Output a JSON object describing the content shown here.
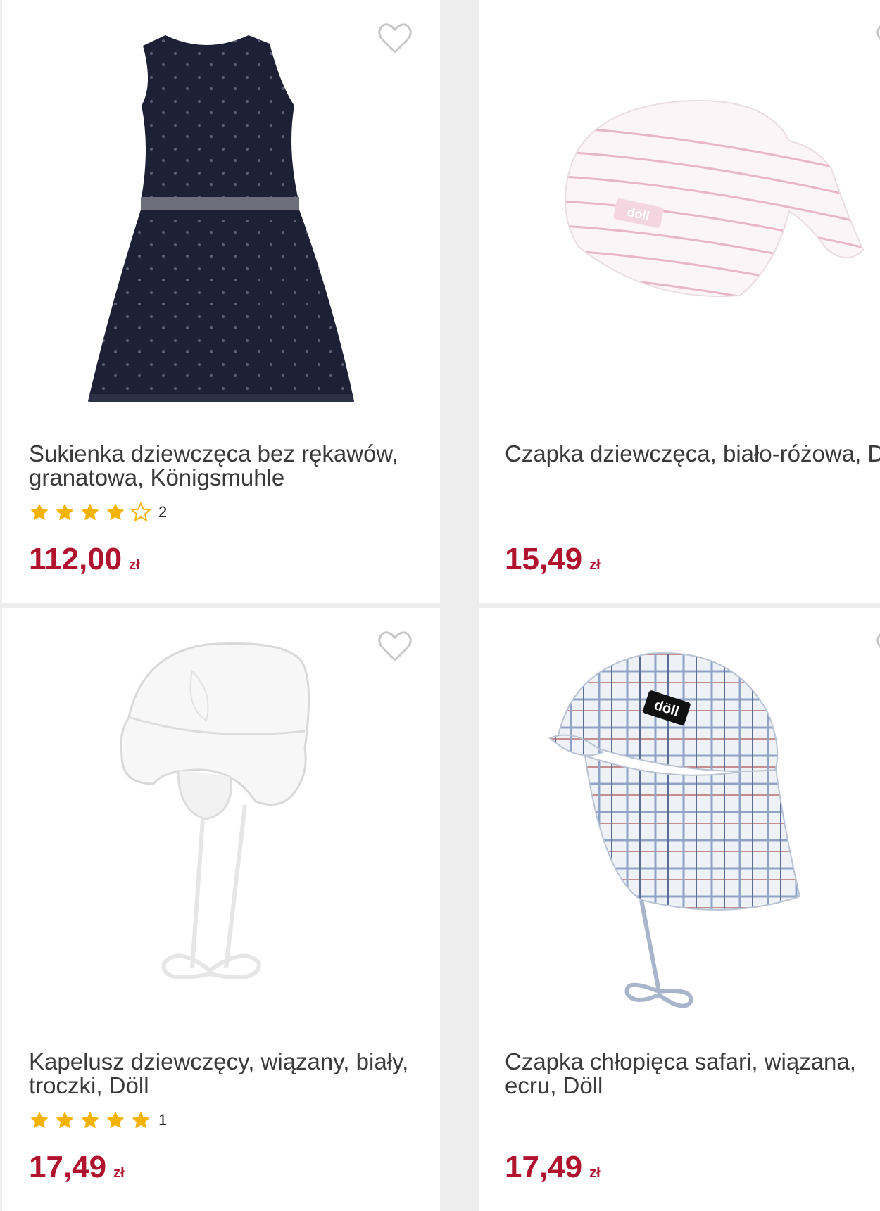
{
  "products": [
    {
      "title": "Sukienka dziewczęca bez rękawów, granatowa, Königsmuhle",
      "rating_stars": 4,
      "rating_count": "2",
      "price": "112,00",
      "currency": "zł",
      "image": "navy-dress"
    },
    {
      "title": "Czapka dziewczęca, biało-różowa, Döll",
      "rating_stars": 0,
      "rating_count": "",
      "price": "15,49",
      "currency": "zł",
      "image": "pink-striped-hat",
      "image_logo_text": "döll"
    },
    {
      "title": "Kapelusz dziewczęcy, wiązany, biały, troczki, Döll",
      "rating_stars": 5,
      "rating_count": "1",
      "price": "17,49",
      "currency": "zł",
      "image": "white-bonnet"
    },
    {
      "title": "Czapka chłopięca safari, wiązana, ecru, Döll",
      "rating_stars": 0,
      "rating_count": "",
      "price": "17,49",
      "currency": "zł",
      "image": "plaid-safari-cap",
      "image_logo_text": "döll"
    }
  ],
  "colors": {
    "price": "#b0132e",
    "star": "#f5b300",
    "heart_outline": "#c8c8c8",
    "title": "#3a3a3a"
  },
  "icons": {
    "favorite": "heart-outline-icon",
    "rating_full": "star-filled-icon",
    "rating_empty": "star-outline-icon"
  }
}
